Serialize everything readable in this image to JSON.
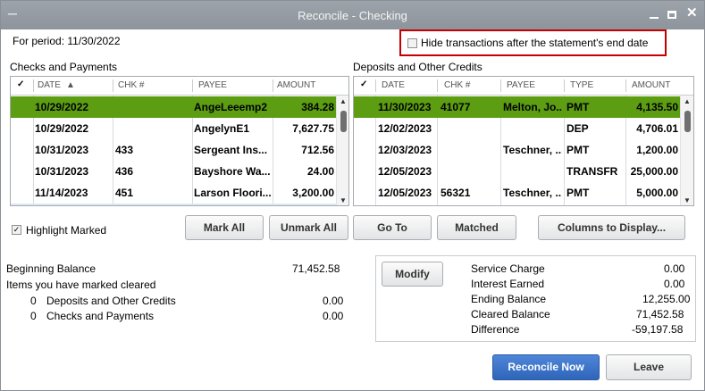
{
  "window": {
    "title": "Reconcile - Checking"
  },
  "period": {
    "label": "For period: 11/30/2022"
  },
  "hide_option": {
    "label": "Hide transactions after the statement's end date",
    "checked": false
  },
  "checks": {
    "title": "Checks and Payments",
    "columns": [
      "✓",
      "DATE",
      "CHK #",
      "PAYEE",
      "AMOUNT"
    ],
    "rows": [
      {
        "date": "10/29/2022",
        "chk": "",
        "payee": "AngeLeeemp2",
        "amount": "384.28",
        "selected": true
      },
      {
        "date": "10/29/2022",
        "chk": "",
        "payee": "AngelynE1",
        "amount": "7,627.75",
        "selected": false
      },
      {
        "date": "10/31/2023",
        "chk": "433",
        "payee": "Sergeant Ins...",
        "amount": "712.56",
        "selected": false
      },
      {
        "date": "10/31/2023",
        "chk": "436",
        "payee": "Bayshore Wa...",
        "amount": "24.00",
        "selected": false
      },
      {
        "date": "11/14/2023",
        "chk": "451",
        "payee": "Larson Floori...",
        "amount": "3,200.00",
        "selected": false
      }
    ]
  },
  "deposits": {
    "title": "Deposits and Other Credits",
    "columns": [
      "✓",
      "DATE",
      "CHK #",
      "PAYEE",
      "TYPE",
      "AMOUNT"
    ],
    "rows": [
      {
        "date": "11/30/2023",
        "chk": "41077",
        "payee": "Melton, Jo...",
        "type": "PMT",
        "amount": "4,135.50",
        "selected": true
      },
      {
        "date": "12/02/2023",
        "chk": "",
        "payee": "",
        "type": "DEP",
        "amount": "4,706.01",
        "selected": false
      },
      {
        "date": "12/03/2023",
        "chk": "",
        "payee": "Teschner, ...",
        "type": "PMT",
        "amount": "1,200.00",
        "selected": false
      },
      {
        "date": "12/05/2023",
        "chk": "",
        "payee": "",
        "type": "TRANSFR",
        "amount": "25,000.00",
        "selected": false
      },
      {
        "date": "12/05/2023",
        "chk": "56321",
        "payee": "Teschner, ...",
        "type": "PMT",
        "amount": "5,000.00",
        "selected": false
      }
    ]
  },
  "highlight_marked": {
    "label": "Highlight Marked",
    "checked": true
  },
  "buttons": {
    "mark_all": "Mark All",
    "unmark_all": "Unmark All",
    "go_to": "Go To",
    "matched": "Matched",
    "columns_to_display": "Columns to Display...",
    "modify": "Modify",
    "reconcile_now": "Reconcile Now",
    "leave": "Leave"
  },
  "summary": {
    "beginning_balance_label": "Beginning Balance",
    "beginning_balance_value": "71,452.58",
    "items_marked_label": "Items you have marked cleared",
    "deposits_count": "0",
    "deposits_label": "Deposits and Other Credits",
    "deposits_value": "0.00",
    "checks_count": "0",
    "checks_label": "Checks and Payments",
    "checks_value": "0.00"
  },
  "totals": {
    "service_charge_label": "Service Charge",
    "service_charge_value": "0.00",
    "interest_earned_label": "Interest Earned",
    "interest_earned_value": "0.00",
    "ending_balance_label": "Ending Balance",
    "ending_balance_value": "12,255.00",
    "cleared_balance_label": "Cleared Balance",
    "cleared_balance_value": "71,452.58",
    "difference_label": "Difference",
    "difference_value": "-59,197.58"
  },
  "colors": {
    "selected_row": "#5c9d12",
    "highlight_border": "#c40000",
    "primary_button": "#3a70c4"
  }
}
